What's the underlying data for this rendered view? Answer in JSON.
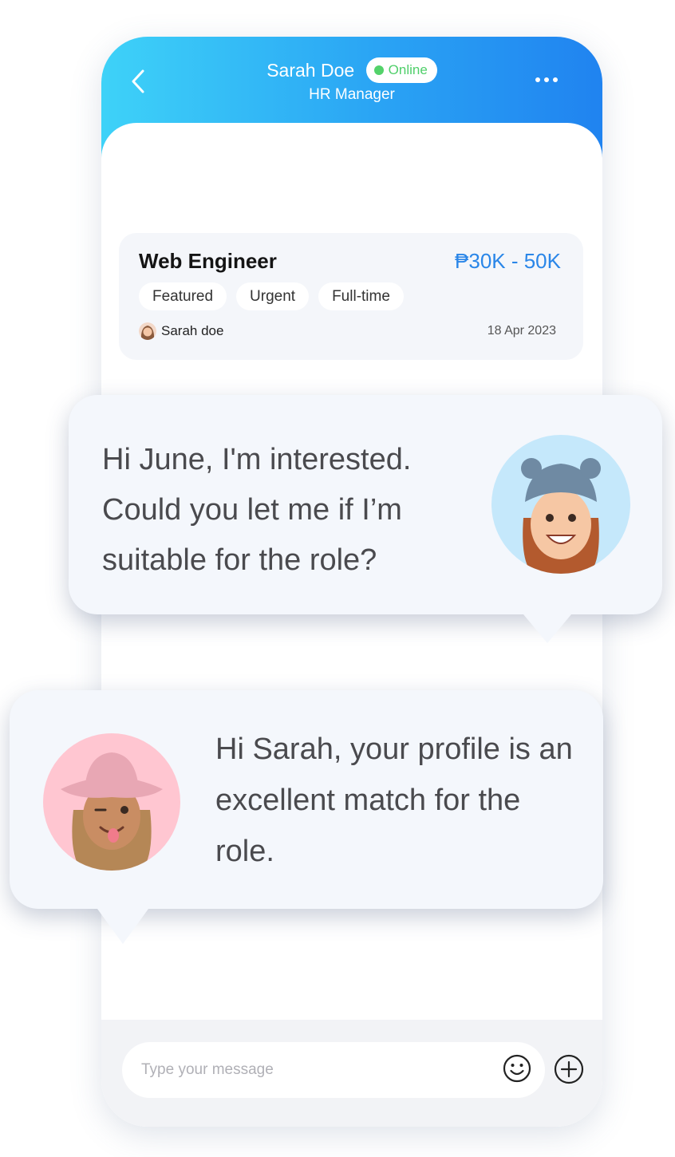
{
  "header": {
    "name": "Sarah Doe",
    "status": "Online",
    "role": "HR Manager",
    "icons": {
      "back": "chevron-left-icon",
      "more": "more-horizontal-icon"
    }
  },
  "job_card": {
    "title": "Web Engineer",
    "salary": "₱30K - 50K",
    "tags": [
      "Featured",
      "Urgent",
      "Full-time"
    ],
    "poster": "Sarah doe",
    "date": "18 Apr 2023"
  },
  "messages": [
    {
      "text": "Hi June, I'm interested. Could you let me if I’m suitable for the role?"
    },
    {
      "text": "Hi Sarah, your profile is an excellent match for the role."
    }
  ],
  "composer": {
    "placeholder": "Type your message",
    "icons": {
      "emoji": "smiley-icon",
      "add": "plus-circle-icon"
    }
  },
  "colors": {
    "header_gradient_start": "#3ed2f8",
    "header_gradient_end": "#2083f0",
    "salary": "#2a86e8",
    "online": "#53d26a"
  }
}
